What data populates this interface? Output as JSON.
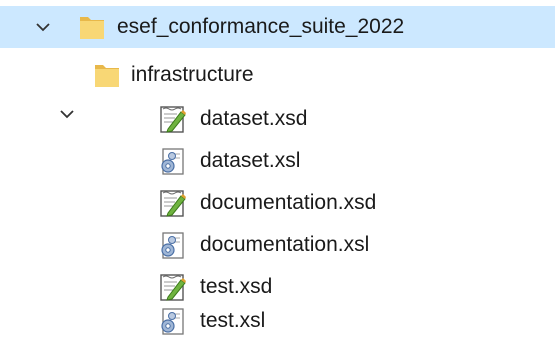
{
  "tree": {
    "root": {
      "label": "esef_conformance_suite_2022",
      "icon": "folder-icon",
      "expanded": true,
      "selected": true
    },
    "folders": [
      {
        "label": "infrastructure",
        "icon": "folder-icon",
        "expanded": true,
        "files": [
          {
            "label": "dataset.xsd",
            "icon": "xsd-file-icon"
          },
          {
            "label": "dataset.xsl",
            "icon": "xsl-file-icon"
          },
          {
            "label": "documentation.xsd",
            "icon": "xsd-file-icon"
          },
          {
            "label": "documentation.xsl",
            "icon": "xsl-file-icon"
          },
          {
            "label": "test.xsd",
            "icon": "xsd-file-icon"
          },
          {
            "label": "test.xsl",
            "icon": "xsl-file-icon"
          }
        ]
      }
    ]
  },
  "colors": {
    "selection": "#cce8ff",
    "folder": "#f8d775",
    "folder_dark": "#e8b84a",
    "text": "#1a1a1a"
  }
}
